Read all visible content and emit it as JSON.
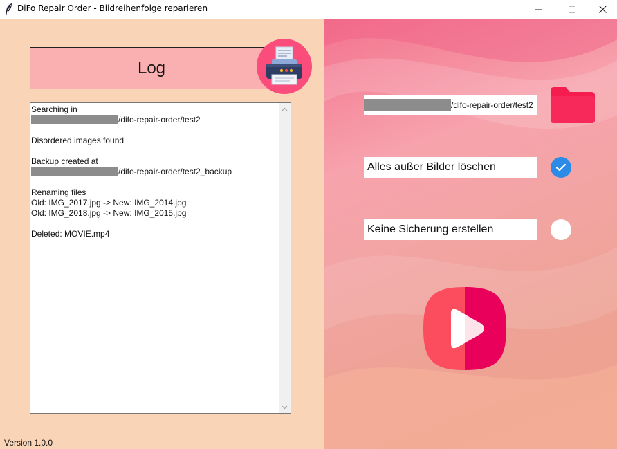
{
  "window": {
    "title": "DiFo Repair Order - Bildreihenfolge reparieren",
    "minimize_icon": "minimize-icon",
    "maximize_icon": "maximize-icon",
    "close_icon": "close-icon"
  },
  "log_panel": {
    "header": "Log",
    "printer_icon": "printer-icon",
    "lines": [
      "Searching in",
      "/difo-repair-order/test2",
      "",
      "Disordered images found",
      "",
      "Backup created at",
      "/difo-repair-order/test2_backup",
      "",
      "Renaming files",
      "Old: IMG_2017.jpg -> New: IMG_2014.jpg",
      "Old: IMG_2018.jpg -> New: IMG_2015.jpg",
      "",
      "Deleted: MOVIE.mp4"
    ],
    "version": "Version 1.0.0"
  },
  "options": {
    "path_value": "/difo-repair-order/test2",
    "folder_icon": "folder-icon",
    "delete_non_images_label": "Alles außer Bilder löschen",
    "delete_non_images_checked": true,
    "no_backup_label": "Keine Sicherung erstellen",
    "no_backup_checked": false,
    "play_icon": "play-icon"
  },
  "colors": {
    "left_bg": "#f9d4b7",
    "log_header_bg": "#faafb0",
    "printer_circle": "#fb4d7c",
    "check_on": "#2b8be6",
    "folder": "#f51d4f",
    "play_left": "#fb4d5d",
    "play_right": "#e8005a"
  }
}
